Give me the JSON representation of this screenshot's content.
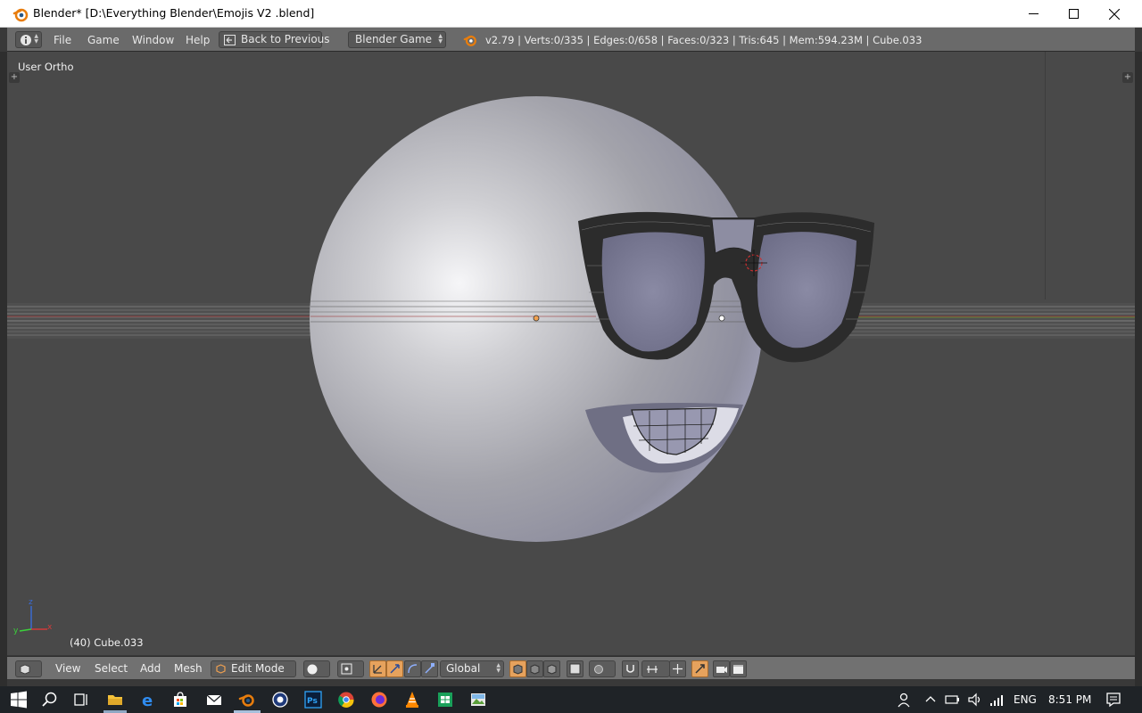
{
  "window": {
    "title": "Blender* [D:\\Everything Blender\\Emojis V2 .blend]",
    "minimize": "—",
    "maximize": "☐",
    "close": "✕"
  },
  "menubar": {
    "info_icon": "info-icon",
    "items": [
      "File",
      "Game",
      "Window",
      "Help"
    ],
    "back_button": "Back to Previous",
    "engine": "Blender Game",
    "stats": "v2.79 | Verts:0/335 | Edges:0/658 | Faces:0/323 | Tris:645 | Mem:594.23M | Cube.033"
  },
  "viewport": {
    "view_label": "User Ortho",
    "object_label": "(40) Cube.033",
    "axis_labels": {
      "x": "x",
      "y": "y",
      "z": "z"
    }
  },
  "bottombar": {
    "items": [
      "View",
      "Select",
      "Add",
      "Mesh"
    ],
    "mode": "Edit Mode",
    "orientation": "Global"
  },
  "taskbar": {
    "language": "ENG",
    "time": "8:51 PM"
  },
  "colors": {
    "viewport_bg": "#494949",
    "header_bg": "#6a6a6a",
    "accent_orange": "#e6a25d",
    "taskbar_bg": "#1f2327"
  }
}
